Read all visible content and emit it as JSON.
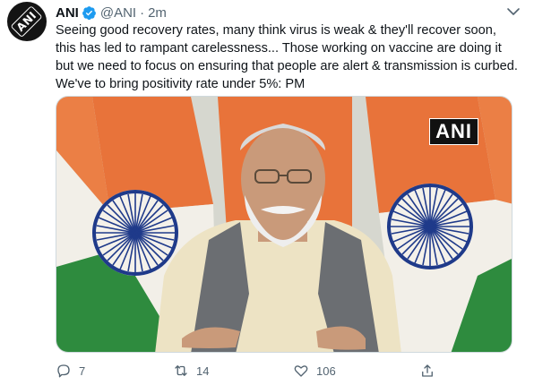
{
  "author": {
    "name": "ANI",
    "handle": "@ANI",
    "separator": "·",
    "time": "2m",
    "avatar_mark": "ANI",
    "verified_color": "#1d9bf0"
  },
  "tweet": {
    "text": "Seeing good recovery rates, many think virus is weak & they'll recover soon, this has led to rampant carelessness... Those working on vaccine are doing it but we need to focus on ensuring that people are alert & transmission is curbed. We've to bring positivity rate under 5%: PM"
  },
  "media": {
    "watermark": "ANI",
    "flag_colors": {
      "saffron": "#e8733a",
      "white": "#f2efe8",
      "green": "#2e8b3e",
      "chakra": "#1f3a8a"
    }
  },
  "actions": {
    "reply_count": "7",
    "retweet_count": "14",
    "like_count": "106",
    "icon_color": "#536471"
  }
}
